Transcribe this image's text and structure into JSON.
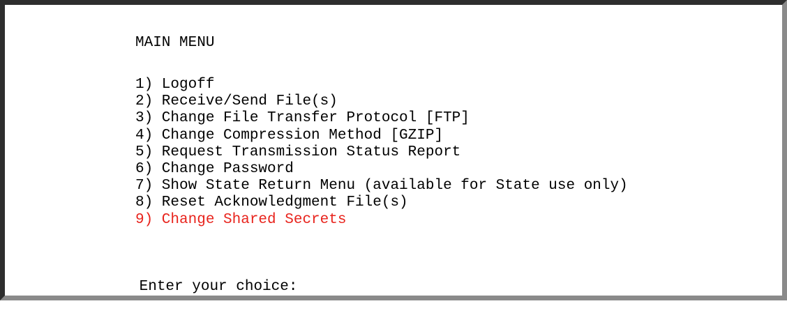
{
  "menu": {
    "title": "MAIN MENU",
    "items": [
      {
        "label": "1) Logoff"
      },
      {
        "label": "2) Receive/Send File(s)"
      },
      {
        "label": "3) Change File Transfer Protocol [FTP]"
      },
      {
        "label": "4) Change Compression Method [GZIP]"
      },
      {
        "label": "5) Request Transmission Status Report"
      },
      {
        "label": "6) Change Password"
      },
      {
        "label": "7) Show State Return Menu (available for State use only)"
      },
      {
        "label": "8) Reset Acknowledgment File(s)"
      },
      {
        "label": "9) Change Shared Secrets"
      }
    ],
    "highlight_color": "#e8231c"
  },
  "prompt": {
    "label": "Enter your choice:",
    "value": ""
  }
}
